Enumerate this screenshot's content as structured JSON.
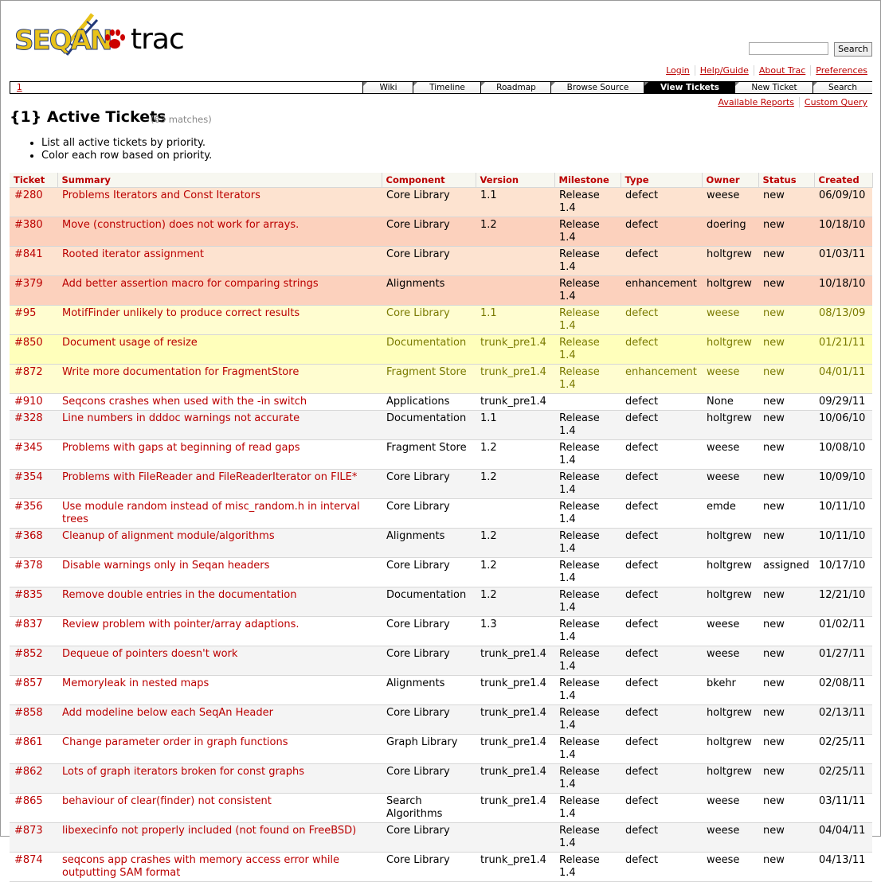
{
  "logo": {
    "brand": "SEQAN",
    "product": "trac"
  },
  "search": {
    "placeholder": "",
    "button_label": "Search"
  },
  "metanav": [
    "Login",
    "Help/Guide",
    "About Trac",
    "Preferences"
  ],
  "mainnav": {
    "context": "1",
    "tabs": [
      {
        "label": "Wiki",
        "active": false
      },
      {
        "label": "Timeline",
        "active": false
      },
      {
        "label": "Roadmap",
        "active": false
      },
      {
        "label": "Browse Source",
        "active": false
      },
      {
        "label": "View Tickets",
        "active": true
      },
      {
        "label": "New Ticket",
        "active": false
      },
      {
        "label": "Search",
        "active": false
      }
    ]
  },
  "ctxtnav": [
    "Available Reports",
    "Custom Query"
  ],
  "report": {
    "title": "{1} Active Tickets",
    "matches": "(63 matches)",
    "description": [
      "List all active tickets by priority.",
      "Color each row based on priority."
    ]
  },
  "columns": [
    "Ticket",
    "Summary",
    "Component",
    "Version",
    "Milestone",
    "Type",
    "Owner",
    "Status",
    "Created"
  ],
  "tickets": [
    {
      "id": "#280",
      "summary": "Problems Iterators and Const Iterators",
      "component": "Core Library",
      "version": "1.1",
      "milestone": "Release 1.4",
      "type": "defect",
      "owner": "weese",
      "status": "new",
      "created": "06/09/10",
      "priority": "p1"
    },
    {
      "id": "#380",
      "summary": "Move (construction) does not work for arrays.",
      "component": "Core Library",
      "version": "1.2",
      "milestone": "Release 1.4",
      "type": "defect",
      "owner": "doering",
      "status": "new",
      "created": "10/18/10",
      "priority": "p1b"
    },
    {
      "id": "#841",
      "summary": "Rooted iterator assignment",
      "component": "Core Library",
      "version": "",
      "milestone": "Release 1.4",
      "type": "defect",
      "owner": "holtgrew",
      "status": "new",
      "created": "01/03/11",
      "priority": "p1"
    },
    {
      "id": "#379",
      "summary": "Add better assertion macro for comparing strings",
      "component": "Alignments",
      "version": "",
      "milestone": "Release 1.4",
      "type": "enhancement",
      "owner": "holtgrew",
      "status": "new",
      "created": "10/18/10",
      "priority": "p1b"
    },
    {
      "id": "#95",
      "summary": "MotifFinder unlikely to produce correct results",
      "component": "Core Library",
      "version": "1.1",
      "milestone": "Release 1.4",
      "type": "defect",
      "owner": "weese",
      "status": "new",
      "created": "08/13/09",
      "priority": "p2"
    },
    {
      "id": "#850",
      "summary": "Document usage of resize",
      "component": "Documentation",
      "version": "trunk_pre1.4",
      "milestone": "Release 1.4",
      "type": "defect",
      "owner": "holtgrew",
      "status": "new",
      "created": "01/21/11",
      "priority": "p2b"
    },
    {
      "id": "#872",
      "summary": "Write more documentation for FragmentStore",
      "component": "Fragment Store",
      "version": "trunk_pre1.4",
      "milestone": "Release 1.4",
      "type": "enhancement",
      "owner": "weese",
      "status": "new",
      "created": "04/01/11",
      "priority": "p2"
    },
    {
      "id": "#910",
      "summary": "Seqcons crashes when used with the -in switch",
      "component": "Applications",
      "version": "trunk_pre1.4",
      "milestone": "",
      "type": "defect",
      "owner": "None",
      "status": "new",
      "created": "09/29/11",
      "priority": "p3",
      "single": true
    },
    {
      "id": "#328",
      "summary": "Line numbers in dddoc warnings not accurate",
      "component": "Documentation",
      "version": "1.1",
      "milestone": "Release 1.4",
      "type": "defect",
      "owner": "holtgrew",
      "status": "new",
      "created": "10/06/10",
      "priority": "p3b"
    },
    {
      "id": "#345",
      "summary": "Problems with gaps at beginning of read gaps",
      "component": "Fragment Store",
      "version": "1.2",
      "milestone": "Release 1.4",
      "type": "defect",
      "owner": "weese",
      "status": "new",
      "created": "10/08/10",
      "priority": "p3"
    },
    {
      "id": "#354",
      "summary": "Problems with FileReader and FileReaderIterator on FILE*",
      "component": "Core Library",
      "version": "1.2",
      "milestone": "Release 1.4",
      "type": "defect",
      "owner": "weese",
      "status": "new",
      "created": "10/09/10",
      "priority": "p3b"
    },
    {
      "id": "#356",
      "summary": "Use module random instead of misc_random.h in interval trees",
      "component": "Core Library",
      "version": "",
      "milestone": "Release 1.4",
      "type": "defect",
      "owner": "emde",
      "status": "new",
      "created": "10/11/10",
      "priority": "p3"
    },
    {
      "id": "#368",
      "summary": "Cleanup of alignment module/algorithms",
      "component": "Alignments",
      "version": "1.2",
      "milestone": "Release 1.4",
      "type": "defect",
      "owner": "holtgrew",
      "status": "new",
      "created": "10/11/10",
      "priority": "p3b"
    },
    {
      "id": "#378",
      "summary": "Disable warnings only in Seqan headers",
      "component": "Core Library",
      "version": "1.2",
      "milestone": "Release 1.4",
      "type": "defect",
      "owner": "holtgrew",
      "status": "assigned",
      "created": "10/17/10",
      "priority": "p3"
    },
    {
      "id": "#835",
      "summary": "Remove double entries in the documentation",
      "component": "Documentation",
      "version": "1.2",
      "milestone": "Release 1.4",
      "type": "defect",
      "owner": "holtgrew",
      "status": "new",
      "created": "12/21/10",
      "priority": "p3b"
    },
    {
      "id": "#837",
      "summary": "Review problem with pointer/array adaptions.",
      "component": "Core Library",
      "version": "1.3",
      "milestone": "Release 1.4",
      "type": "defect",
      "owner": "weese",
      "status": "new",
      "created": "01/02/11",
      "priority": "p3"
    },
    {
      "id": "#852",
      "summary": "Dequeue of pointers doesn't work",
      "component": "Core Library",
      "version": "trunk_pre1.4",
      "milestone": "Release 1.4",
      "type": "defect",
      "owner": "weese",
      "status": "new",
      "created": "01/27/11",
      "priority": "p3b"
    },
    {
      "id": "#857",
      "summary": "Memoryleak in nested maps",
      "component": "Alignments",
      "version": "trunk_pre1.4",
      "milestone": "Release 1.4",
      "type": "defect",
      "owner": "bkehr",
      "status": "new",
      "created": "02/08/11",
      "priority": "p3"
    },
    {
      "id": "#858",
      "summary": "Add modeline below each SeqAn Header",
      "component": "Core Library",
      "version": "trunk_pre1.4",
      "milestone": "Release 1.4",
      "type": "defect",
      "owner": "holtgrew",
      "status": "new",
      "created": "02/13/11",
      "priority": "p3b"
    },
    {
      "id": "#861",
      "summary": "Change parameter order in graph functions",
      "component": "Graph Library",
      "version": "trunk_pre1.4",
      "milestone": "Release 1.4",
      "type": "defect",
      "owner": "holtgrew",
      "status": "new",
      "created": "02/25/11",
      "priority": "p3"
    },
    {
      "id": "#862",
      "summary": "Lots of graph iterators broken for const graphs",
      "component": "Core Library",
      "version": "trunk_pre1.4",
      "milestone": "Release 1.4",
      "type": "defect",
      "owner": "holtgrew",
      "status": "new",
      "created": "02/25/11",
      "priority": "p3b"
    },
    {
      "id": "#865",
      "summary": "behaviour of clear(finder) not consistent",
      "component": "Search Algorithms",
      "version": "trunk_pre1.4",
      "milestone": "Release 1.4",
      "type": "defect",
      "owner": "weese",
      "status": "new",
      "created": "03/11/11",
      "priority": "p3"
    },
    {
      "id": "#873",
      "summary": "libexecinfo not properly included (not found on FreeBSD)",
      "component": "Core Library",
      "version": "",
      "milestone": "Release 1.4",
      "type": "defect",
      "owner": "weese",
      "status": "new",
      "created": "04/04/11",
      "priority": "p3b"
    },
    {
      "id": "#874",
      "summary": "seqcons app crashes with memory access error while outputting SAM format",
      "component": "Core Library",
      "version": "trunk_pre1.4",
      "milestone": "Release 1.4",
      "type": "defect",
      "owner": "weese",
      "status": "new",
      "created": "04/13/11",
      "priority": "p3"
    }
  ]
}
